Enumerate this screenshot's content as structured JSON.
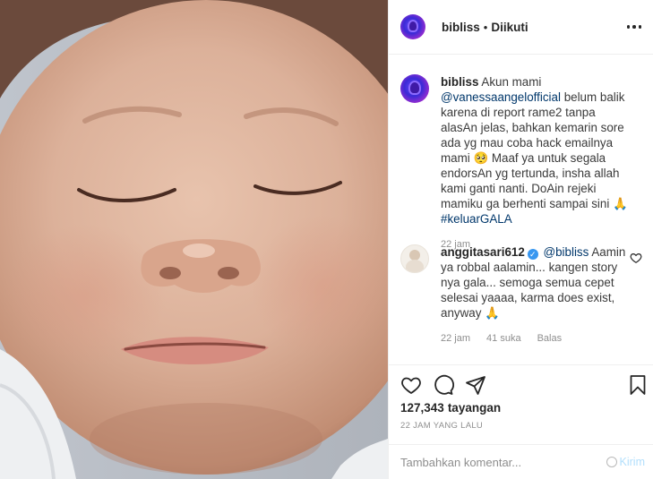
{
  "colors": {
    "text": "#262626",
    "muted": "#8e8e8e",
    "link": "#00376b",
    "verified": "#3897f0",
    "post_button": "#b2dffc",
    "border": "#efefef"
  },
  "media": {
    "kind": "video",
    "icon": "baby-photo"
  },
  "header": {
    "username": "bibliss",
    "separator": "•",
    "follow_status": "Diikuti",
    "more_icon": "more-horizontal-icon"
  },
  "caption": {
    "username": "bibliss",
    "text_before_mention": "Akun mami",
    "mention": "@vanessaangelofficial",
    "text_after_mention": "belum balik karena di report rame2 tanpa alasAn jelas, bahkan kemarin sore ada yg mau coba hack emailnya mami 🥺 Maaf ya untuk segala endorsAn yg tertunda, insha allah kami ganti nanti. DoAin rejeki mamiku ga berhenti sampai sini 🙏",
    "hashtag": "#keluarGALA",
    "time": "22 jam"
  },
  "comments": [
    {
      "username": "anggitasari612",
      "verified": true,
      "mention": "@bibliss",
      "text": "Aamin ya robbal aalamin... kangen story nya gala... semoga semua cepet selesai yaaaa, karma does exist, anyway 🙏",
      "time": "22 jam",
      "likes": "41 suka",
      "reply_label": "Balas"
    }
  ],
  "actions": {
    "like_icon": "heart-icon",
    "comment_icon": "comment-icon",
    "share_icon": "share-icon",
    "save_icon": "bookmark-icon"
  },
  "stats": {
    "views": "127,343",
    "views_label": "tayangan",
    "posted": "22 JAM YANG LALU"
  },
  "comment_box": {
    "placeholder": "Tambahkan komentar...",
    "post_label": "Kirim"
  }
}
